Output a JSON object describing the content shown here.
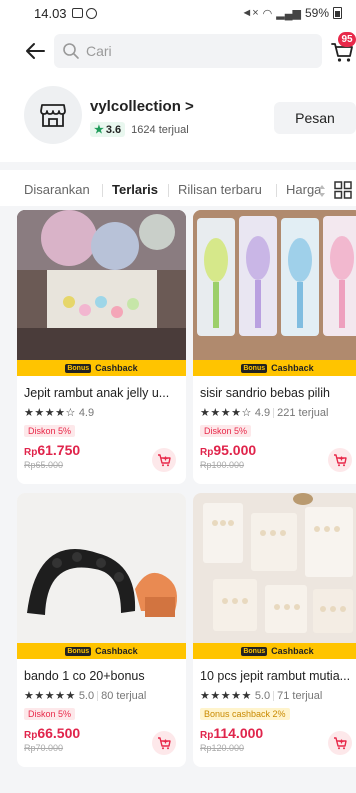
{
  "status_bar": {
    "time": "14.03",
    "battery": "59%"
  },
  "search": {
    "placeholder": "Cari"
  },
  "cart": {
    "badge_count": "95"
  },
  "store": {
    "name": "vylcollection",
    "chevron": ">",
    "rating": "3.6",
    "sold": "1624 terjual",
    "pesan_label": "Pesan"
  },
  "tabs": [
    {
      "label": "Disarankan",
      "active": false
    },
    {
      "label": "Terlaris",
      "active": true
    },
    {
      "label": "Rilisan terbaru",
      "active": false
    },
    {
      "label": "Harga",
      "active": false
    }
  ],
  "colors": {
    "accent": "#e8294a",
    "price": "#e0244b",
    "cashback": "#ffc400",
    "rating_star": "#1e9c5a"
  },
  "products": [
    {
      "cashback_tag": "Bonus",
      "cashback_label": "Cashback",
      "title": "Jepit rambut anak jelly u...",
      "stars": "★★★★☆",
      "rating": "4.9",
      "sold": "",
      "discount": "Diskon 5%",
      "price_currency": "Rp",
      "price": "61.750",
      "old_price": "Rp65.000",
      "icon": "cart-plus-icon"
    },
    {
      "cashback_tag": "Bonus",
      "cashback_label": "Cashback",
      "title": "sisir sandrio bebas pilih",
      "stars": "★★★★☆",
      "rating": "4.9",
      "sold": "221 terjual",
      "discount": "Diskon 5%",
      "price_currency": "Rp",
      "price": "95.000",
      "old_price": "Rp100.000",
      "icon": "cart-plus-icon"
    },
    {
      "cashback_tag": "Bonus",
      "cashback_label": "Cashback",
      "title": "bando 1 co 20+bonus",
      "stars": "★★★★★",
      "rating": "5.0",
      "sold": "80 terjual",
      "discount": "Diskon 5%",
      "price_currency": "Rp",
      "price": "66.500",
      "old_price": "Rp70.000",
      "icon": "cart-plus-icon"
    },
    {
      "cashback_tag": "Bonus",
      "cashback_label": "Cashback",
      "title": "10 pcs jepit rambut mutia...",
      "stars": "★★★★★",
      "rating": "5.0",
      "sold": "71 terjual",
      "discount": "Bonus cashback 2%",
      "price_currency": "Rp",
      "price": "114.000",
      "old_price": "Rp120.000",
      "icon": "cart-plus-icon"
    }
  ]
}
